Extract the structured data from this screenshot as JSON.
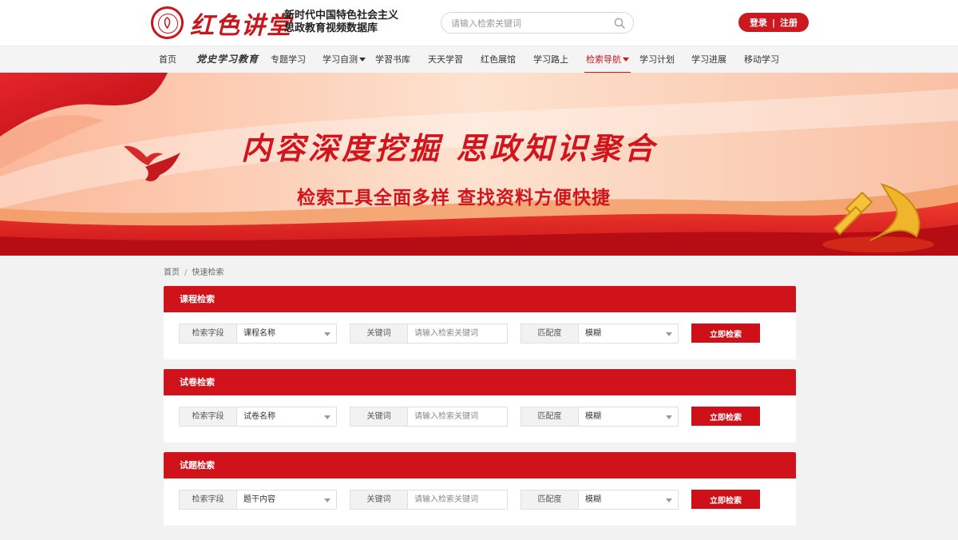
{
  "header": {
    "logo_text": "红色讲堂",
    "tagline_line1": "新时代中国特色社会主义",
    "tagline_line2": "思政教育视频数据库",
    "search_placeholder": "请输入检索关键词",
    "login_label": "登录",
    "auth_separator": "|",
    "register_label": "注册"
  },
  "nav": {
    "items": [
      {
        "label": "首页"
      },
      {
        "label": "党史学习教育"
      },
      {
        "label": "专题学习"
      },
      {
        "label": "学习自测"
      },
      {
        "label": "学習书库"
      },
      {
        "label": "天天学習"
      },
      {
        "label": "红色展馆"
      },
      {
        "label": "学习路上"
      },
      {
        "label": "检索导航"
      },
      {
        "label": "学习计划"
      },
      {
        "label": "学习进展"
      },
      {
        "label": "移动学习"
      }
    ],
    "active_index": 8
  },
  "banner": {
    "title": "内容深度挖掘 思政知识聚合",
    "subtitle": "检索工具全面多样 查找资料方便快捷"
  },
  "breadcrumb": {
    "home": "首页",
    "separator": "/",
    "current": "快速检索"
  },
  "panels": [
    {
      "title": "课程检索",
      "field_label": "检索字段",
      "field_value": "课程名称",
      "keyword_label": "关键词",
      "keyword_placeholder": "请输入检索关键词",
      "match_label": "匹配度",
      "match_value": "模糊",
      "button_label": "立即检索"
    },
    {
      "title": "试卷检索",
      "field_label": "检索字段",
      "field_value": "试卷名称",
      "keyword_label": "关键词",
      "keyword_placeholder": "请输入检索关键词",
      "match_label": "匹配度",
      "match_value": "模糊",
      "button_label": "立即检索"
    },
    {
      "title": "试题检索",
      "field_label": "检索字段",
      "field_value": "题干内容",
      "keyword_label": "关键词",
      "keyword_placeholder": "请输入检索关键词",
      "match_label": "匹配度",
      "match_value": "模糊",
      "button_label": "立即检索"
    }
  ],
  "colors": {
    "brand_red": "#c8161d",
    "header_bar_red": "#d0121b",
    "nav_bg": "#f4f4f4",
    "page_bg": "#f2f2f2"
  },
  "icons": {
    "logo": "seal-logo-icon",
    "search": "search-icon",
    "dropdown": "chevron-down-icon",
    "banner_emblem": "hammer-sickle-icon",
    "banner_doves": "dove-icon"
  }
}
